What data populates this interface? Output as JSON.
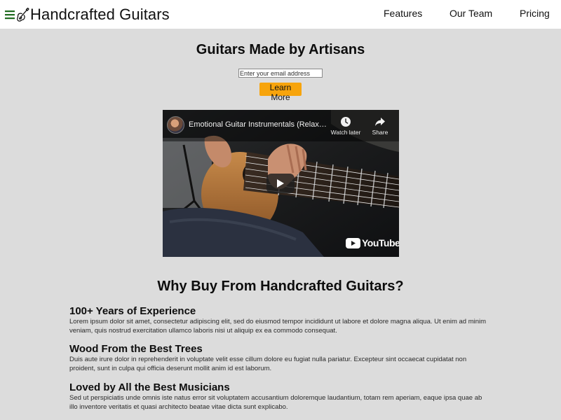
{
  "header": {
    "brand": "Handcrafted Guitars",
    "nav": [
      {
        "label": "Features"
      },
      {
        "label": "Our Team"
      },
      {
        "label": "Pricing"
      }
    ]
  },
  "hero": {
    "title": "Guitars Made by Artisans",
    "email_placeholder": "Enter your email address",
    "email_value": "",
    "cta_label": "Learn More"
  },
  "video": {
    "title": "Emotional Guitar Instrumentals (Relaxi…",
    "watch_later_label": "Watch later",
    "share_label": "Share",
    "logo_text": "YouTube"
  },
  "why": {
    "title": "Why Buy From Handcrafted Guitars?",
    "features": [
      {
        "heading": "100+ Years of Experience",
        "text": "Lorem ipsum dolor sit amet, consectetur adipiscing elit, sed do eiusmod tempor incididunt ut labore et dolore magna aliqua. Ut enim ad minim veniam, quis nostrud exercitation ullamco laboris nisi ut aliquip ex ea commodo consequat."
      },
      {
        "heading": "Wood From the Best Trees",
        "text": "Duis aute irure dolor in reprehenderit in voluptate velit esse cillum dolore eu fugiat nulla pariatur. Excepteur sint occaecat cupidatat non proident, sunt in culpa qui officia deserunt mollit anim id est laborum."
      },
      {
        "heading": "Loved by All the Best Musicians",
        "text": "Sed ut perspiciatis unde omnis iste natus error sit voluptatem accusantium doloremque laudantium, totam rem aperiam, eaque ipsa quae ab illo inventore veritatis et quasi architecto beatae vitae dicta sunt explicabo."
      }
    ]
  },
  "icons": {
    "menu": "hamburger-menu-icon",
    "logo": "guitar-icon",
    "watch_later": "clock-icon",
    "share": "share-arrow-icon",
    "play": "play-icon",
    "youtube": "youtube-logo-icon"
  },
  "colors": {
    "page_background": "#dcdcdc",
    "header_background": "#ffffff",
    "menu_icon": "#1f6b1f",
    "cta_background": "#f7a40c",
    "text": "#111111"
  }
}
